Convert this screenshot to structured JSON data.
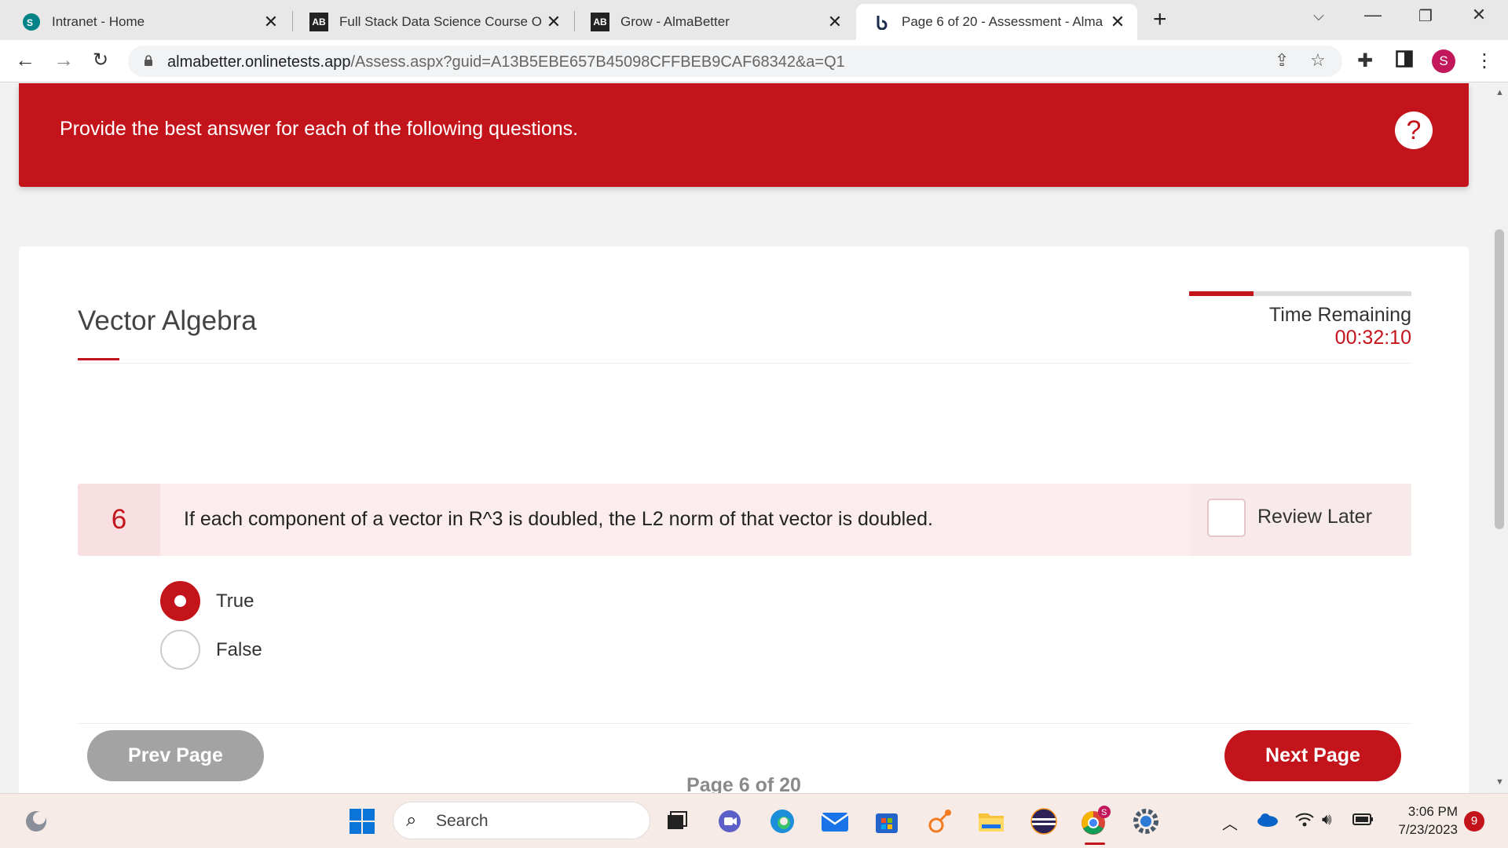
{
  "browser": {
    "tabs": [
      {
        "title": "Intranet - Home",
        "icon": "sharepoint-icon"
      },
      {
        "title": "Full Stack Data Science Course O",
        "icon": "almabetter-icon"
      },
      {
        "title": "Grow - AlmaBetter",
        "icon": "almabetter-icon"
      },
      {
        "title": "Page 6 of 20 - Assessment - Alma",
        "icon": "onlinetests-icon",
        "active": true
      }
    ],
    "url_host": "almabetter.onlinetests.app",
    "url_path": "/Assess.aspx?guid=A13B5EBE657B45098CFFBEB9CAF68342&a=Q1",
    "profile_initial": "S"
  },
  "banner": {
    "message": "Provide the best answer for each of the following questions.",
    "help_label": "?"
  },
  "assessment": {
    "section_title": "Vector Algebra",
    "time_label": "Time Remaining",
    "time_value": "00:32:10",
    "time_elapsed_fraction": 0.29,
    "question": {
      "number": "6",
      "text": "If each component of a vector in R^3 is doubled, the L2 norm of that vector is doubled.",
      "review_label": "Review Later",
      "review_checked": false,
      "options": [
        {
          "label": "True",
          "selected": true
        },
        {
          "label": "False",
          "selected": false
        }
      ]
    },
    "page_indicator": "Page 6 of 20",
    "prev_label": "Prev Page",
    "next_label": "Next Page"
  },
  "colors": {
    "accent": "#c4141b",
    "banner_bg": "#c4141b",
    "question_bg": "#fbedee",
    "prev_button": "#a3a3a3"
  },
  "taskbar": {
    "search_placeholder": "Search",
    "time": "3:06 PM",
    "date": "7/23/2023",
    "notification_count": "9"
  }
}
